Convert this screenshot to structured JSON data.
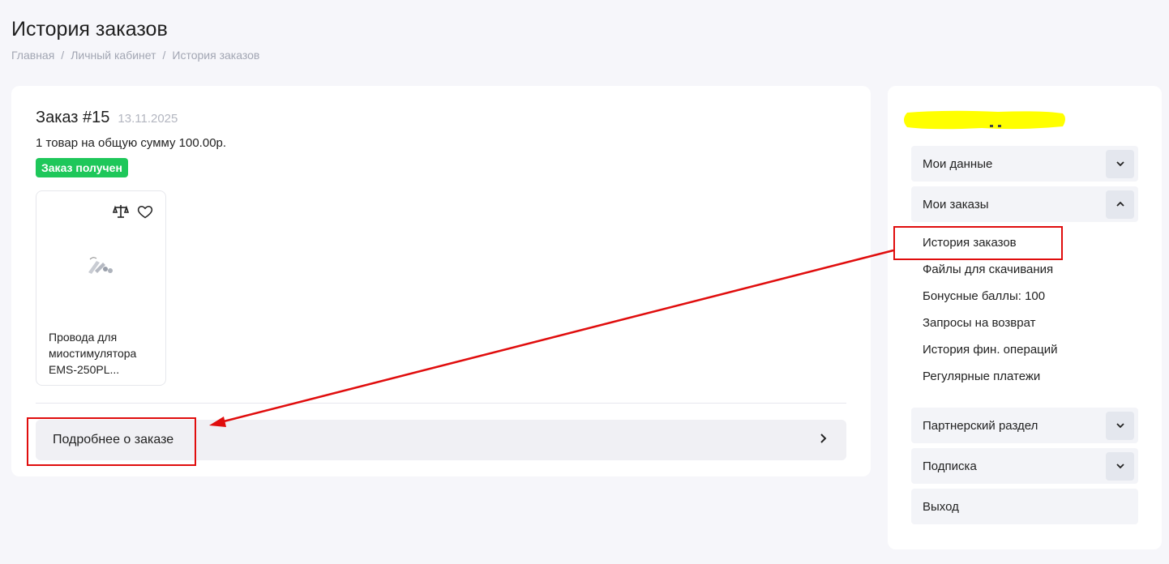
{
  "page": {
    "title": "История заказов",
    "breadcrumb": [
      "Главная",
      "Личный кабинет",
      "История заказов"
    ],
    "breadcrumb_separator": "/"
  },
  "order": {
    "title": "Заказ #15",
    "date": "13.11.2025",
    "summary": "1 товар на общую сумму 100.00р.",
    "status": "Заказ получен",
    "status_color": "#1ec75a",
    "product": {
      "name": "Провода для миостимулятора EMS-250PL...",
      "icons": [
        "compare-icon",
        "heart-icon"
      ]
    },
    "details_label": "Подробнее о заказе"
  },
  "sidebar": {
    "groups": [
      {
        "label": "Мои данные",
        "expanded": false
      },
      {
        "label": "Мои заказы",
        "expanded": true
      }
    ],
    "orders_items": [
      "История заказов",
      "Файлы для скачивания",
      "Бонусные баллы: 100",
      "Запросы на возврат",
      "История фин. операций",
      "Регулярные платежи"
    ],
    "bottom_groups": [
      {
        "label": "Партнерский раздел",
        "expanded": false
      },
      {
        "label": "Подписка",
        "expanded": false
      },
      {
        "label": "Выход"
      }
    ]
  },
  "annotations": {
    "highlight_color": "#e00d0d",
    "redaction_color": "#ffff00"
  }
}
